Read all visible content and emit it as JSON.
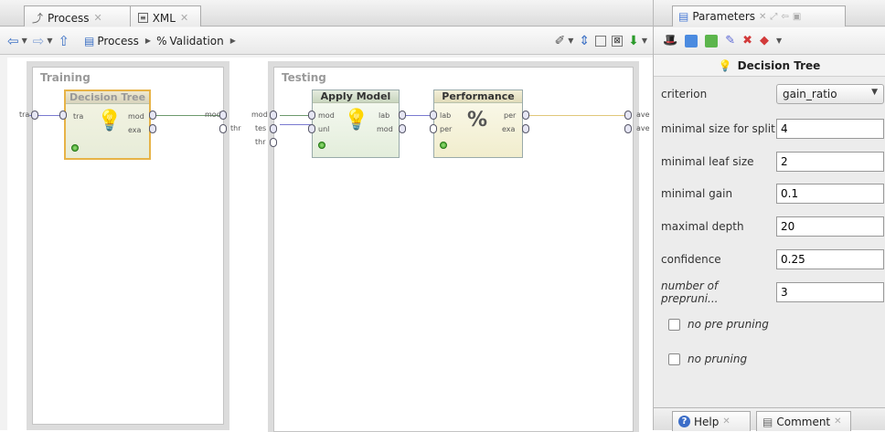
{
  "left_tabs": {
    "process": "Process",
    "xml": "XML"
  },
  "toolbar": {
    "breadcrumb_process": "Process",
    "breadcrumb_validation": "Validation"
  },
  "canvas": {
    "training": {
      "title": "Training",
      "in_port": "tra",
      "operator": {
        "name": "Decision Tree",
        "in_port": "tra",
        "out_ports": [
          "mod",
          "exa"
        ]
      },
      "out_port": "mod"
    },
    "testing": {
      "title": "Testing",
      "in_ports": [
        "mod",
        "tes",
        "thr"
      ],
      "apply_model": {
        "name": "Apply Model",
        "in_ports": [
          "mod",
          "unl"
        ],
        "out_ports": [
          "lab",
          "mod"
        ]
      },
      "performance": {
        "name": "Performance",
        "in_ports": [
          "lab",
          "per"
        ],
        "out_ports": [
          "per",
          "exa"
        ]
      },
      "out_ports": [
        "ave",
        "ave"
      ]
    },
    "thr_port": "thr"
  },
  "parameters": {
    "tab_label": "Parameters",
    "operator_title": "Decision Tree",
    "rows": [
      {
        "label": "criterion",
        "value": "gain_ratio",
        "type": "select"
      },
      {
        "label": "minimal size for split",
        "value": "4",
        "type": "input"
      },
      {
        "label": "minimal leaf size",
        "value": "2",
        "type": "input"
      },
      {
        "label": "minimal gain",
        "value": "0.1",
        "type": "input"
      },
      {
        "label": "maximal depth",
        "value": "20",
        "type": "input"
      },
      {
        "label": "confidence",
        "value": "0.25",
        "type": "input"
      },
      {
        "label": "number of prepruning alternatives",
        "display": "number of prepruni...",
        "value": "3",
        "type": "input"
      }
    ],
    "checkboxes": [
      {
        "label": "no pre pruning",
        "checked": false
      },
      {
        "label": "no pruning",
        "checked": false
      }
    ]
  },
  "bottom_tabs": {
    "help": "Help",
    "comment": "Comment"
  }
}
